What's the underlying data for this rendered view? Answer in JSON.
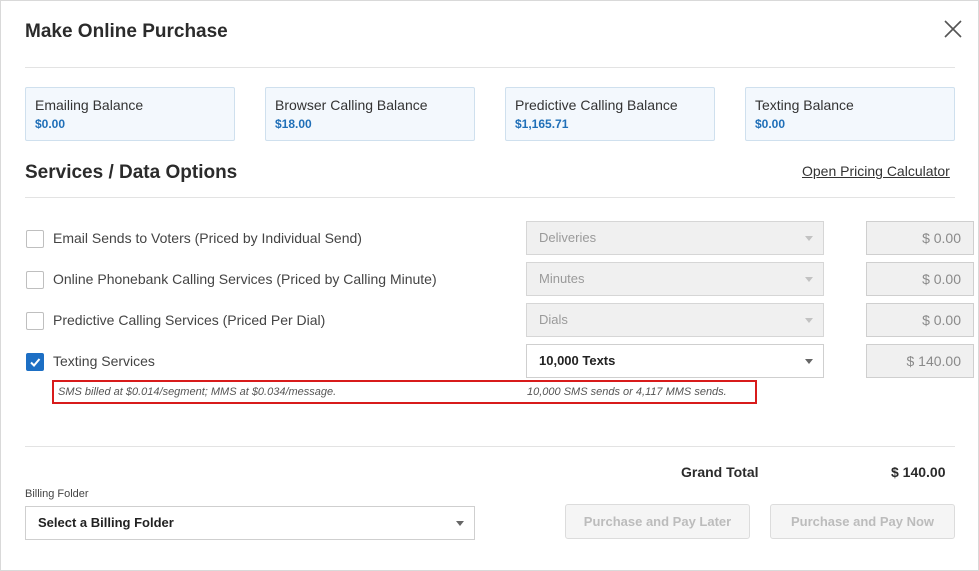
{
  "modal": {
    "title": "Make Online Purchase"
  },
  "balances": [
    {
      "label": "Emailing Balance",
      "value": "$0.00"
    },
    {
      "label": "Browser Calling Balance",
      "value": "$18.00"
    },
    {
      "label": "Predictive Calling Balance",
      "value": "$1,165.71"
    },
    {
      "label": "Texting Balance",
      "value": "$0.00"
    }
  ],
  "services_section": {
    "title": "Services / Data Options",
    "pricing_link": "Open Pricing Calculator"
  },
  "services": [
    {
      "label": "Email Sends to Voters (Priced by Individual Send)",
      "checked": false,
      "select_value": "Deliveries",
      "price": "$ 0.00"
    },
    {
      "label": "Online Phonebank Calling Services (Priced by Calling Minute)",
      "checked": false,
      "select_value": "Minutes",
      "price": "$ 0.00"
    },
    {
      "label": "Predictive Calling Services (Priced Per Dial)",
      "checked": false,
      "select_value": "Dials",
      "price": "$ 0.00"
    },
    {
      "label": "Texting Services",
      "checked": true,
      "select_value": "10,000 Texts",
      "price": "$ 140.00"
    }
  ],
  "texting_note": {
    "rate": "SMS billed at $0.014/segment; MMS at $0.034/message.",
    "estimate": "10,000 SMS sends or 4,117 MMS sends."
  },
  "totals": {
    "label": "Grand Total",
    "value": "$ 140.00"
  },
  "billing": {
    "label": "Billing Folder",
    "select_value": "Select a Billing Folder"
  },
  "actions": {
    "pay_later": "Purchase and Pay Later",
    "pay_now": "Purchase and Pay Now"
  },
  "colors": {
    "accent": "#1d6fc4",
    "balance_value": "#1f6fb8",
    "highlight_border": "#d81b1b"
  }
}
